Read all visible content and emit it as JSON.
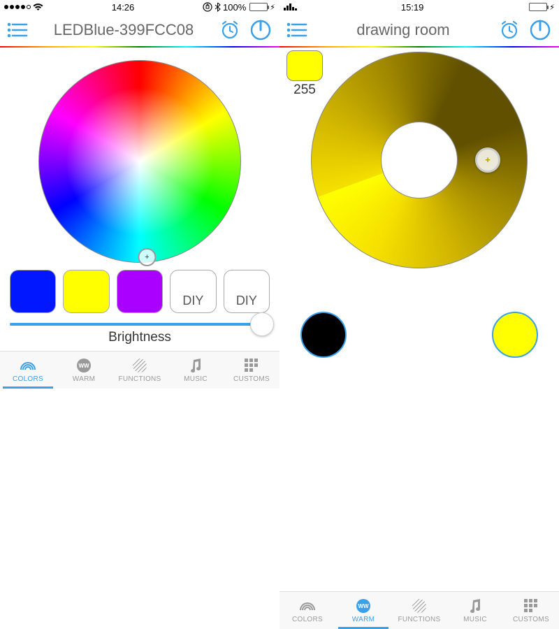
{
  "left": {
    "status": {
      "time": "14:26",
      "battery_pct": "100%",
      "carrier_dots": 4,
      "icons": [
        "lock-rotation",
        "bluetooth"
      ]
    },
    "header": {
      "title": "LEDBlue-399FCC08"
    },
    "swatches": [
      {
        "color": "#0000ff",
        "label": ""
      },
      {
        "color": "#ffff00",
        "label": ""
      },
      {
        "color": "#aa00ff",
        "label": ""
      },
      {
        "color": "#ffffff",
        "label": "DIY"
      },
      {
        "color": "#ffffff",
        "label": "DIY"
      }
    ],
    "brightness": {
      "label": "Brightness",
      "value_pct": 96
    }
  },
  "right": {
    "status": {
      "time": "15:19",
      "battery_pct": "",
      "bars": [
        4,
        7,
        10,
        5,
        3
      ]
    },
    "header": {
      "title": "drawing room"
    },
    "current": {
      "color": "#ffff00",
      "value": "255"
    },
    "presets": [
      {
        "color": "#000000"
      },
      {
        "color": "#ffff00"
      }
    ]
  },
  "tabs": [
    {
      "id": "colors",
      "label": "COLORS"
    },
    {
      "id": "warm",
      "label": "WARM"
    },
    {
      "id": "functions",
      "label": "FUNCTIONS"
    },
    {
      "id": "music",
      "label": "MUSIC"
    },
    {
      "id": "customs",
      "label": "CUSTOMS"
    }
  ],
  "colors": {
    "accent": "#3aa0e8"
  }
}
